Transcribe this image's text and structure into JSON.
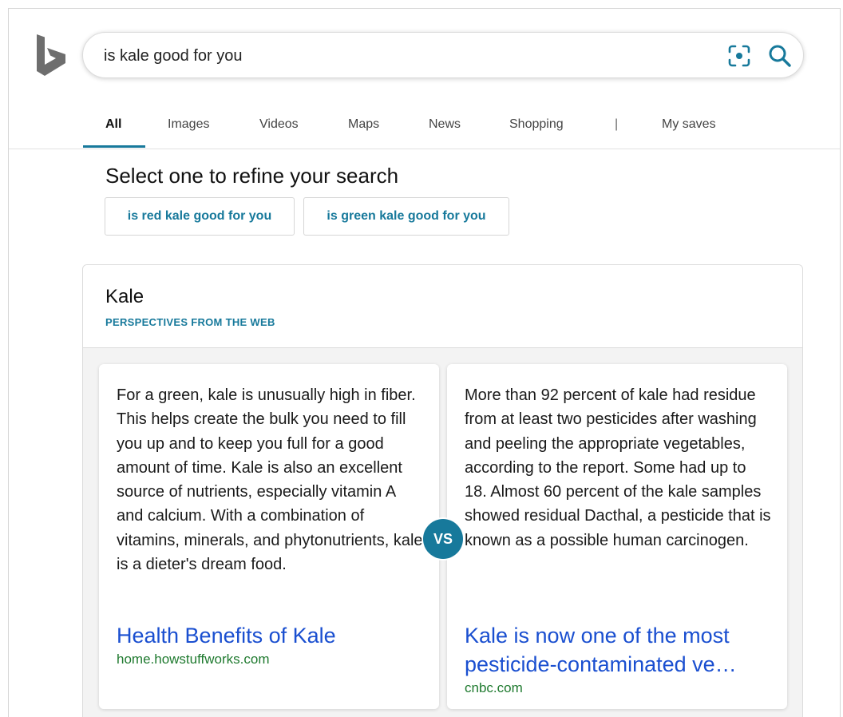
{
  "search": {
    "query": "is kale good for you",
    "visual_search_icon": "camera-scan-icon",
    "search_icon": "magnifier-icon"
  },
  "tabs": [
    {
      "label": "All",
      "active": true
    },
    {
      "label": "Images"
    },
    {
      "label": "Videos"
    },
    {
      "label": "Maps"
    },
    {
      "label": "News"
    },
    {
      "label": "Shopping"
    },
    {
      "label": "My saves"
    }
  ],
  "tab_separator": "|",
  "refine": {
    "title": "Select one to refine your search",
    "chips": [
      "is red kale good for you",
      "is green kale good for you"
    ]
  },
  "perspectives": {
    "title": "Kale",
    "subtitle": "PERSPECTIVES FROM THE WEB",
    "vs_label": "VS",
    "left": {
      "text": "For a green, kale is unusually high in fiber. This helps create the bulk you need to fill you up and to keep you full for a good amount of time. Kale is also an excellent source of nutrients, especially vitamin A and calcium. With a combination of vitamins, minerals, and phytonutrients, kale is a dieter's dream food.",
      "link": "Health Benefits of Kale",
      "source": "home.howstuffworks.com"
    },
    "right": {
      "text": "More than 92 percent of kale had residue from at least two pesticides after washing and peeling the appropriate vegetables, according to the report. Some had up to 18. Almost 60 percent of the kale samples showed residual Dacthal, a pesticide that is known as a possible human carcinogen.",
      "link": "Kale is now one of the most pesticide-contaminated ve…",
      "source": "cnbc.com"
    }
  },
  "colors": {
    "accent": "#17799b",
    "link": "#1a4fd0",
    "source": "#1f7a2f"
  }
}
